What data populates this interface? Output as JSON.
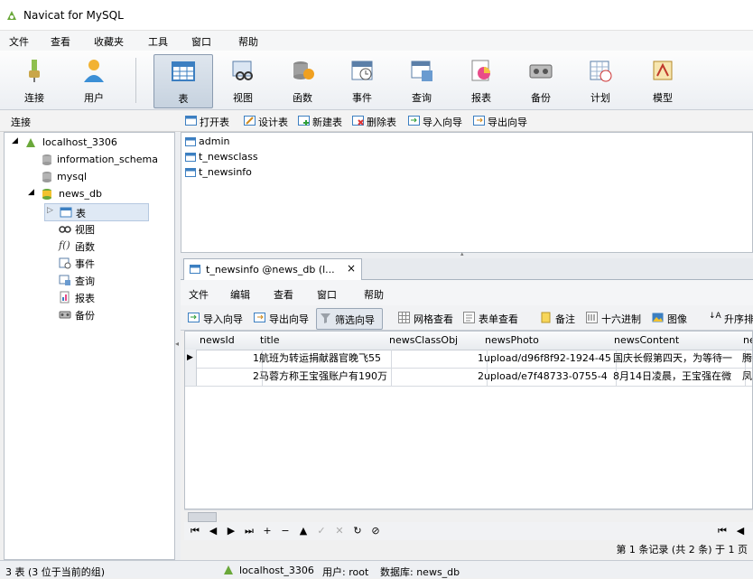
{
  "app": {
    "title": "Navicat for MySQL"
  },
  "menu": [
    "文件",
    "查看",
    "收藏夹",
    "工具",
    "窗口",
    "帮助"
  ],
  "toolbar": [
    "连接",
    "用户",
    "表",
    "视图",
    "函数",
    "事件",
    "查询",
    "报表",
    "备份",
    "计划",
    "模型"
  ],
  "sidebar_header": "连接",
  "object_toolbar": [
    "打开表",
    "设计表",
    "新建表",
    "删除表",
    "导入向导",
    "导出向导"
  ],
  "tree": {
    "connection": "localhost_3306",
    "databases": [
      "information_schema",
      "mysql",
      "news_db"
    ],
    "news_db_children": [
      "表",
      "视图",
      "函数",
      "事件",
      "查询",
      "报表",
      "备份"
    ]
  },
  "tables": [
    "admin",
    "t_newsclass",
    "t_newsinfo"
  ],
  "tab": {
    "label": "t_newsinfo @news_db (l...",
    "close": "×"
  },
  "tab_menu": [
    "文件",
    "编辑",
    "查看",
    "窗口",
    "帮助"
  ],
  "tab_tools": [
    "导入向导",
    "导出向导",
    "筛选向导",
    "网格查看",
    "表单查看",
    "备注",
    "十六进制",
    "图像",
    "升序排"
  ],
  "grid": {
    "columns": [
      "newsId",
      "title",
      "newsClassObj",
      "newsPhoto",
      "newsContent",
      "ne"
    ],
    "rows": [
      [
        "1",
        "航班为转运捐献器官晚飞55",
        "1",
        "upload/d96f8f92-1924-45",
        "国庆长假第四天，为等待一",
        "腾讯"
      ],
      [
        "2",
        "马蓉方称王宝强账户有190万",
        "2",
        "upload/e7f48733-0755-4",
        "8月14日凌晨，王宝强在微",
        "凤凰"
      ]
    ]
  },
  "record_info": "第 1 条记录 (共 2 条) 于 1 页",
  "status": {
    "left": "3 表 (3 位于当前的组)",
    "conn": "localhost_3306",
    "user": "用户: root",
    "db": "数据库: news_db"
  },
  "colors": {
    "accent": "#3c7fc1",
    "selected": "#dfe9f5"
  }
}
